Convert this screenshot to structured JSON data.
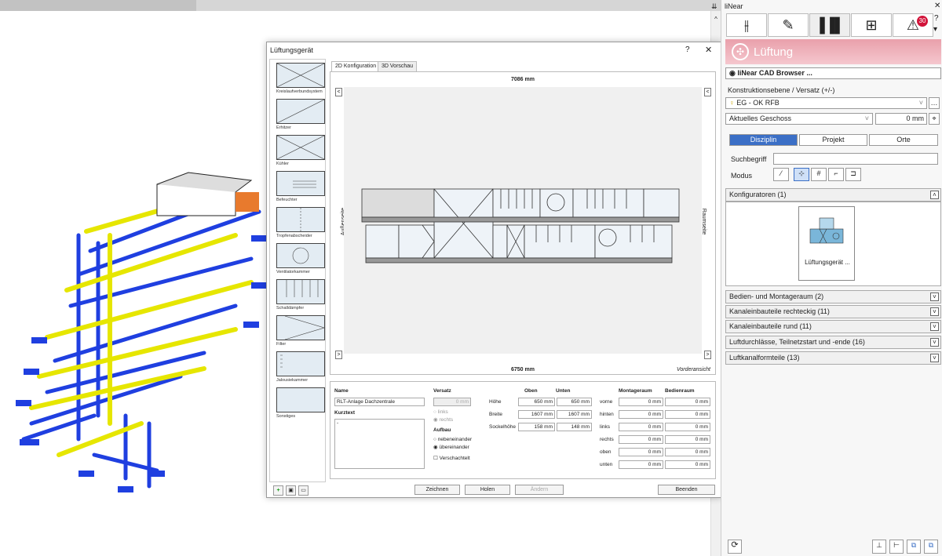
{
  "app": {
    "title": "liNear"
  },
  "dialog": {
    "title": "Lüftungsgerät",
    "help": "?",
    "close": "✕",
    "tabs": [
      "2D Konfiguration",
      "3D Vorschau"
    ],
    "components": [
      "Kreislaufverbundsystem",
      "Erhitzer",
      "Kühler",
      "Befeuchter",
      "Tropfenabscheider",
      "Ventilatorkammer",
      "Schalldämpfer",
      "Filter",
      "Jalousiekammer",
      "Sonstiges"
    ],
    "dim_top": "7086 mm",
    "dim_bottom": "6750 mm",
    "side_left": "Außenseite",
    "side_right": "Raumseite",
    "view_label": "Vorderansicht",
    "name_label": "Name",
    "name_value": "RLT-Anlage Dachzentrale",
    "kurztext_label": "Kurztext",
    "kurztext_value": "-",
    "versatz_label": "Versatz",
    "versatz_value": "0 mm",
    "versatz_links": "links",
    "versatz_rechts": "rechts",
    "aufbau_label": "Aufbau",
    "aufbau_neben": "nebeneinander",
    "aufbau_ueber": "übereinander",
    "verschachtelt": "Verschachtelt",
    "oben_label": "Oben",
    "unten_label": "Unten",
    "dims": [
      {
        "label": "Höhe",
        "oben": "650 mm",
        "unten": "650 mm"
      },
      {
        "label": "Breite",
        "oben": "1607 mm",
        "unten": "1607 mm"
      },
      {
        "label": "Sockelhöhe",
        "oben": "158 mm",
        "unten": "148 mm"
      }
    ],
    "montage_label": "Montageraum",
    "bedien_label": "Bedienraum",
    "raum": [
      {
        "label": "vorne",
        "montage": "0 mm",
        "bedien": "0 mm"
      },
      {
        "label": "hinten",
        "montage": "0 mm",
        "bedien": "0 mm"
      },
      {
        "label": "links",
        "montage": "0 mm",
        "bedien": "0 mm"
      },
      {
        "label": "rechts",
        "montage": "0 mm",
        "bedien": "0 mm"
      },
      {
        "label": "oben",
        "montage": "0 mm",
        "bedien": "0 mm"
      },
      {
        "label": "unten",
        "montage": "0 mm",
        "bedien": "0 mm"
      }
    ],
    "buttons": {
      "zeichnen": "Zeichnen",
      "holen": "Holen",
      "aendern": "Ändern",
      "beenden": "Beenden"
    }
  },
  "panel": {
    "title": "liNear",
    "close": "✕",
    "help": "?",
    "banner": "Lüftung",
    "cad_browser": "liNear CAD Browser ...",
    "ebene_label": "Konstruktionsebene / Versatz (+/-)",
    "ebene_value": "EG - OK RFB",
    "geschoss_value": "Aktuelles Geschoss",
    "offset_value": "0 mm",
    "filter_buttons": [
      "Disziplin",
      "Projekt",
      "Orte"
    ],
    "suchbegriff_label": "Suchbegriff",
    "modus_label": "Modus",
    "categories": [
      "Konfiguratoren (1)",
      "Bedien- und Montageraum (2)",
      "Kanaleinbauteile rechteckig (11)",
      "Kanaleinbauteile rund (11)",
      "Luftdurchlässe, Teilnetzstart und -ende (16)",
      "Luftkanalformteile (13)"
    ],
    "config_item": "Lüftungsgerät ...",
    "badge": "30",
    "accent": "#3b6fc6"
  }
}
